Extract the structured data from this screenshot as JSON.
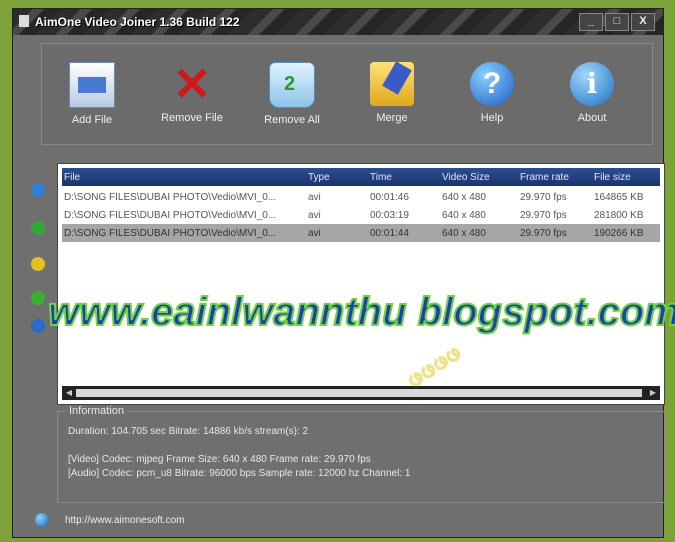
{
  "window": {
    "title": "AimOne Video Joiner 1.36 Build 122",
    "controls": [
      "_",
      "□",
      "X"
    ]
  },
  "toolbar": [
    {
      "label": "Add File",
      "icon": "add-file-icon"
    },
    {
      "label": "Remove File",
      "icon": "remove-file-icon"
    },
    {
      "label": "Remove All",
      "icon": "recycle-bin-icon"
    },
    {
      "label": "Merge",
      "icon": "merge-folder-icon"
    },
    {
      "label": "Help",
      "icon": "help-icon"
    },
    {
      "label": "About",
      "icon": "about-icon"
    }
  ],
  "file_list": {
    "columns": [
      "File",
      "Type",
      "Time",
      "Video Size",
      "Frame rate",
      "File size"
    ],
    "rows": [
      {
        "file": "D:\\SONG FILES\\DUBAI PHOTO\\Vedio\\MVI_0...",
        "type": "avi",
        "time": "00:01:46",
        "video_size": "640 x 480",
        "frame_rate": "29.970 fps",
        "file_size": "164865 KB"
      },
      {
        "file": "D:\\SONG FILES\\DUBAI PHOTO\\Vedio\\MVI_0...",
        "type": "avi",
        "time": "00:03:19",
        "video_size": "640 x 480",
        "frame_rate": "29.970 fps",
        "file_size": "281800 KB"
      },
      {
        "file": "D:\\SONG FILES\\DUBAI PHOTO\\Vedio\\MVI_0...",
        "type": "avi",
        "time": "00:01:44",
        "video_size": "640 x 480",
        "frame_rate": "29.970 fps",
        "file_size": "190266 KB"
      }
    ],
    "selected_row": 2
  },
  "info": {
    "legend": "Information",
    "line1": "Duration: 104.705 sec  Bitrate: 14886 kb/s  stream(s): 2",
    "line2": "[Video] Codec: mjpeg  Frame Size: 640 x 480  Frame rate: 29.970 fps",
    "line3": "[Audio] Codec: pcm_u8  Bitrate: 96000 bps  Sample rate: 12000 hz  Channel: 1"
  },
  "status": {
    "url": "http://www.aimonesoft.com"
  },
  "watermark": {
    "main": "www.eainlwannthu blogspot.com",
    "burmese": "ဖဖဖဖ"
  },
  "colors": {
    "frame": "#7ea23a",
    "window_bg": "#6f6f6f",
    "header_blue": "#1a3470",
    "selected_row": "#a6a6a6"
  }
}
